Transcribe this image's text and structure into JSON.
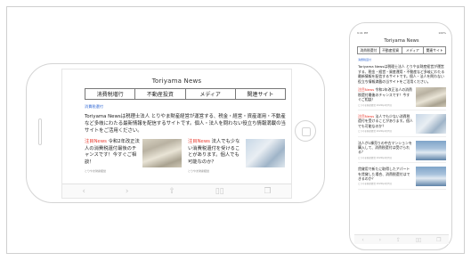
{
  "site": {
    "title": "Toriyama News",
    "nav": [
      "消費税増行",
      "不動産投資",
      "メディア",
      "関連サイト"
    ],
    "category": "消費税還付",
    "intro": "Toriyama Newsは税理士法人 とりやま財産経営が運営する、税金・経営・資産運用・不動産など多岐にわたる最新情報を配信するサイトです。個人・法人を問わない役立ち情報満載の当サイトをご活用ください。"
  },
  "landscape": {
    "cards": [
      {
        "tag": "注目News",
        "text": " 令和2年改正法人の消費税還付最後のチャンスです！今すぐご相談！",
        "meta": "とりやま財産経営"
      },
      {
        "tag": "注目News",
        "text": " 法人でも少ない消費税還付を受けることがあります。個人でも可能なのか？",
        "meta": "とりやま財産経営"
      }
    ],
    "toolbar": [
      "‹",
      "›",
      "⇪",
      "▯▯",
      "❐"
    ]
  },
  "portrait": {
    "status": {
      "time": "9:41 PM",
      "battery": "100%"
    },
    "title": "Toriyama News",
    "nav": [
      "消費税還付",
      "不動産投資",
      "メディア",
      "関連サイト"
    ],
    "category": "消費税還付",
    "intro": "Toriyama Newsは税理士法人 とりやま財産経営が運営する、税金・経営・資産運用・不動産など多岐にわたる最新情報を配信するサイトです。個人・法人を問わない役立ち情報満載の当サイトをご活用ください。",
    "items": [
      {
        "tag": "注目News",
        "text": " 令和2年改正法人の消費税還付最後のチャンスです！今すぐご相談！",
        "meta": "とりやま財産経営 2020年4月7日"
      },
      {
        "tag": "注目News",
        "text": " 法人でも少ない消費税還付を受けることがあります。個人でも可能なのか？",
        "meta": "とりやま財産経営 2020年4月7日"
      },
      {
        "tag": "",
        "text": "法人が1棟売りの中古マンションを購入して、消費税還付は受けられる？",
        "meta": "とりやま財産経営 2020年4月7日"
      },
      {
        "tag": "",
        "text": "賃貸用で新たに取得したアパートを賃貸した場合、消費税還付はできるのか？",
        "meta": "とりやま財産経営 2020年4月7日"
      }
    ],
    "toolbar": [
      "‹",
      "›",
      "⇪",
      "▯▯",
      "❐"
    ]
  }
}
